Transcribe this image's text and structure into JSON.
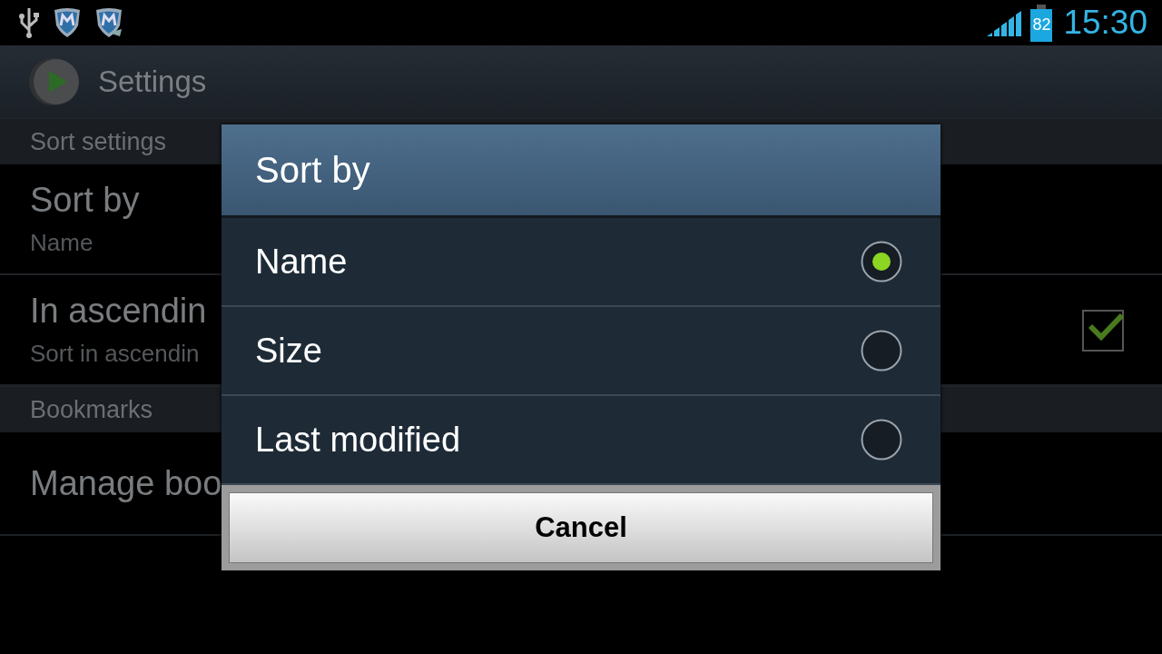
{
  "status_bar": {
    "battery": "82",
    "time": "15:30"
  },
  "action_bar": {
    "title": "Settings"
  },
  "settings": [
    {
      "kind": "header",
      "title": "Sort settings"
    },
    {
      "kind": "item",
      "title": "Sort by",
      "summary": "Name"
    },
    {
      "kind": "checkbox",
      "title": "In ascendin",
      "summary": "Sort in ascendin",
      "checked": true
    },
    {
      "kind": "header",
      "title": "Bookmarks"
    },
    {
      "kind": "item",
      "title": "Manage boo"
    }
  ],
  "dialog": {
    "title": "Sort by",
    "options": [
      {
        "label": "Name",
        "selected": true
      },
      {
        "label": "Size",
        "selected": false
      },
      {
        "label": "Last modified",
        "selected": false
      }
    ],
    "button": "Cancel"
  }
}
